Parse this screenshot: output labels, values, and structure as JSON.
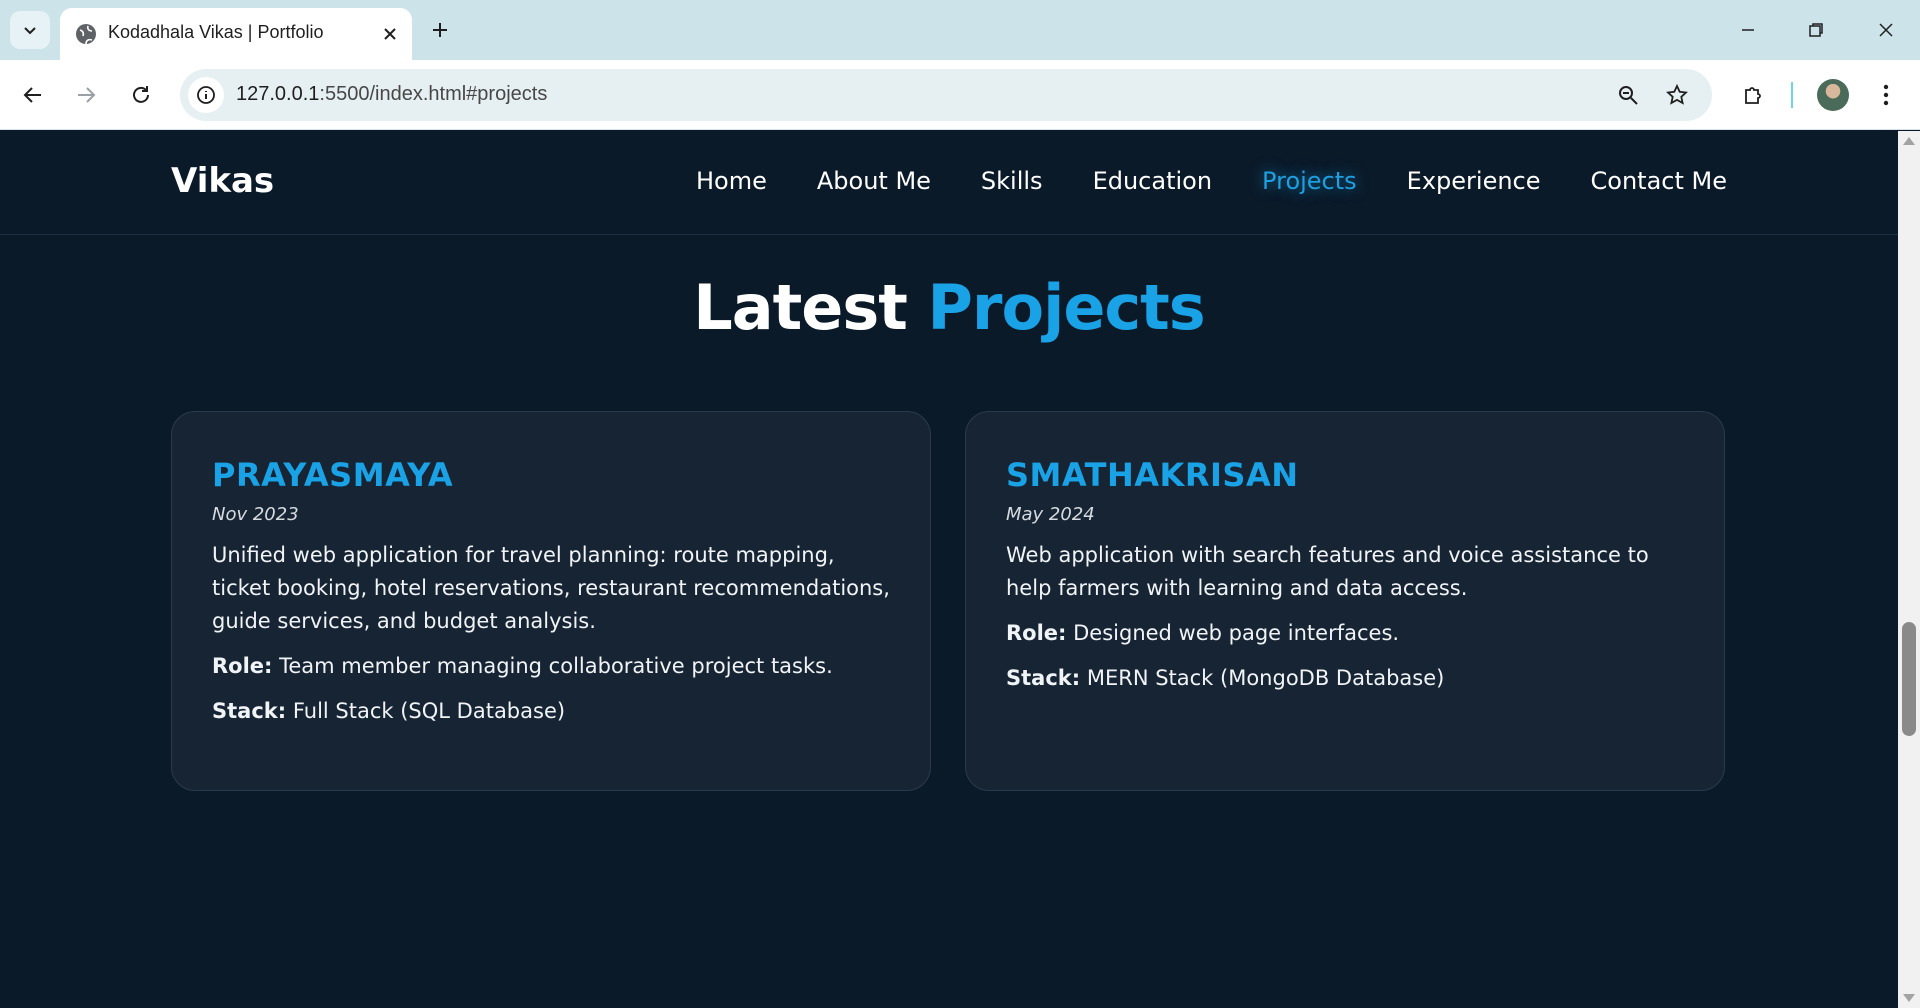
{
  "browser": {
    "tab_title": "Kodadhala Vikas | Portfolio",
    "url_host": "127.0.0.1",
    "url_path": ":5500/index.html#projects"
  },
  "site": {
    "brand": "Vikas",
    "nav": [
      {
        "label": "Home",
        "active": false
      },
      {
        "label": "About Me",
        "active": false
      },
      {
        "label": "Skills",
        "active": false
      },
      {
        "label": "Education",
        "active": false
      },
      {
        "label": "Projects",
        "active": true
      },
      {
        "label": "Experience",
        "active": false
      },
      {
        "label": "Contact Me",
        "active": false
      }
    ],
    "section_title_main": "Latest",
    "section_title_accent": "Projects"
  },
  "projects": [
    {
      "title": "PRAYASMAYA",
      "date": "Nov 2023",
      "description": "Unified web application for travel planning: route mapping, ticket booking, hotel reservations, restaurant recommendations, guide services, and budget analysis.",
      "role_label": "Role:",
      "role": "Team member managing collaborative project tasks.",
      "stack_label": "Stack:",
      "stack": "Full Stack (SQL Database)"
    },
    {
      "title": "SMATHAKRISAN",
      "date": "May 2024",
      "description": "Web application with search features and voice assistance to help farmers with learning and data access.",
      "role_label": "Role:",
      "role": "Designed web page interfaces.",
      "stack_label": "Stack:",
      "stack": "MERN Stack (MongoDB Database)"
    }
  ],
  "colors": {
    "page_bg": "#0b1a29",
    "card_bg": "#172433",
    "accent": "#1aa2e6"
  }
}
